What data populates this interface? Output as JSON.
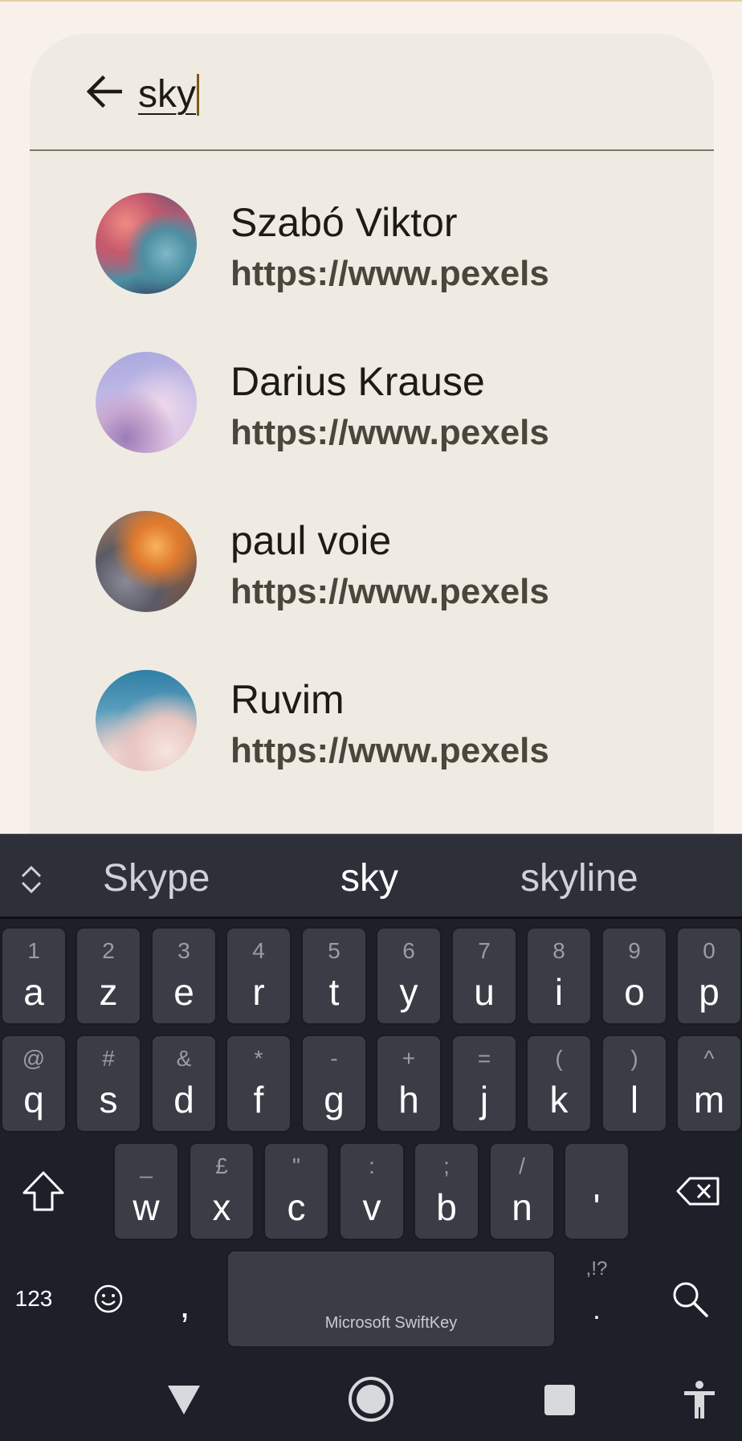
{
  "search": {
    "query": "sky"
  },
  "results": [
    {
      "name": "Szabó Viktor",
      "url": "https://www.pexels"
    },
    {
      "name": "Darius Krause",
      "url": "https://www.pexels"
    },
    {
      "name": "paul voie",
      "url": "https://www.pexels"
    },
    {
      "name": "Ruvim",
      "url": "https://www.pexels"
    }
  ],
  "keyboard": {
    "suggestions": [
      "Skype",
      "sky",
      "skyline"
    ],
    "row1": [
      {
        "hint": "1",
        "key": "a"
      },
      {
        "hint": "2",
        "key": "z"
      },
      {
        "hint": "3",
        "key": "e"
      },
      {
        "hint": "4",
        "key": "r"
      },
      {
        "hint": "5",
        "key": "t"
      },
      {
        "hint": "6",
        "key": "y"
      },
      {
        "hint": "7",
        "key": "u"
      },
      {
        "hint": "8",
        "key": "i"
      },
      {
        "hint": "9",
        "key": "o"
      },
      {
        "hint": "0",
        "key": "p"
      }
    ],
    "row2": [
      {
        "hint": "@",
        "key": "q"
      },
      {
        "hint": "#",
        "key": "s"
      },
      {
        "hint": "&",
        "key": "d"
      },
      {
        "hint": "*",
        "key": "f"
      },
      {
        "hint": "-",
        "key": "g"
      },
      {
        "hint": "+",
        "key": "h"
      },
      {
        "hint": "=",
        "key": "j"
      },
      {
        "hint": "(",
        "key": "k"
      },
      {
        "hint": ")",
        "key": "l"
      },
      {
        "hint": "^",
        "key": "m"
      }
    ],
    "row3": [
      {
        "hint": "_",
        "key": "w"
      },
      {
        "hint": "£",
        "key": "x"
      },
      {
        "hint": "\"",
        "key": "c"
      },
      {
        "hint": ":",
        "key": "v"
      },
      {
        "hint": ";",
        "key": "b"
      },
      {
        "hint": "/",
        "key": "n"
      },
      {
        "hint": "",
        "key": "'"
      }
    ],
    "numbers_label": "123",
    "comma_label": ",",
    "period_label": ".",
    "period_hint": ",!?",
    "space_label": "Microsoft SwiftKey"
  }
}
